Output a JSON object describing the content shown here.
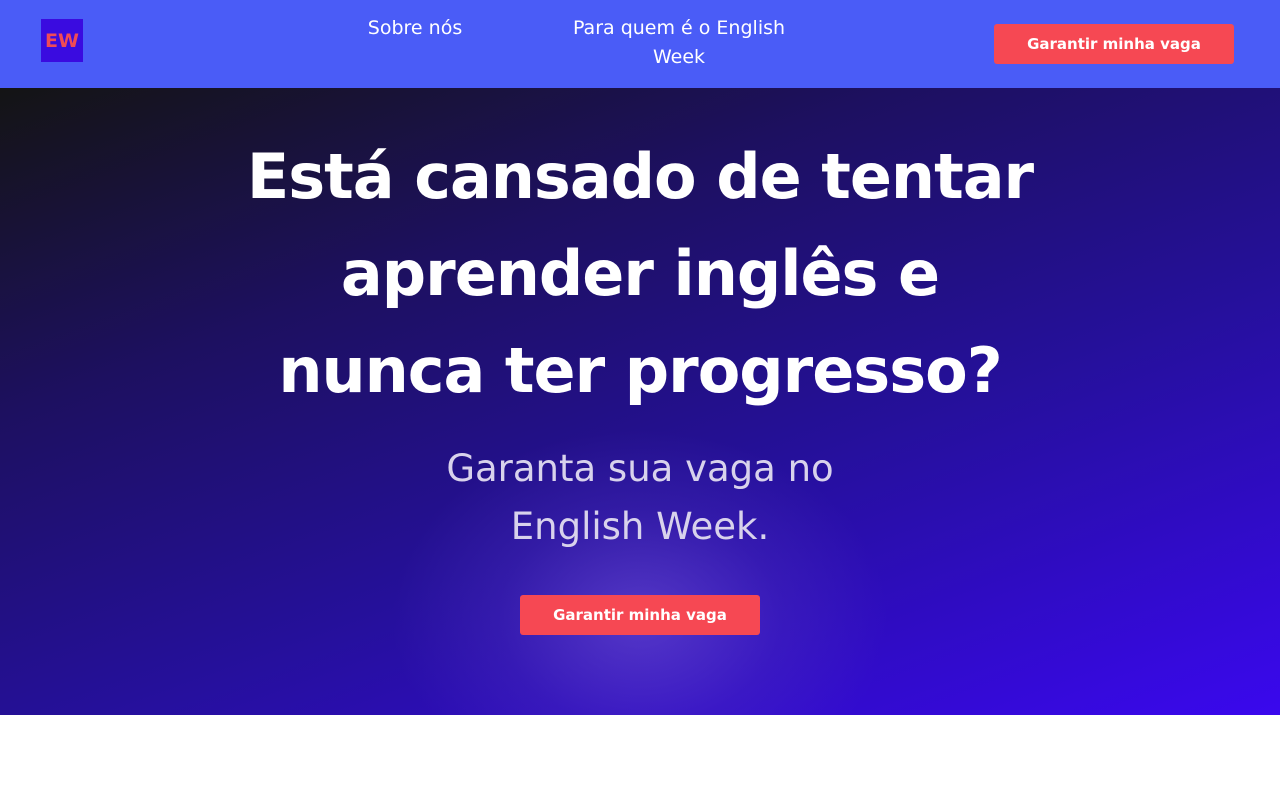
{
  "header": {
    "logo_text": "EW",
    "nav": {
      "about_label": "Sobre nós",
      "who_label": "Para quem é o English Week"
    },
    "cta_label": "Garantir minha vaga"
  },
  "hero": {
    "title": "Está cansado de tentar aprender inglês e nunca ter progresso?",
    "subtitle": "Garanta sua vaga no English Week.",
    "cta_label": "Garantir minha vaga"
  },
  "colors": {
    "header_bg": "#4a5cf7",
    "logo_bg": "#3a0be0",
    "logo_text": "#f04a57",
    "cta_bg": "#f64853",
    "hero_gradient_start": "#141414",
    "hero_gradient_end": "#3a08ee"
  }
}
